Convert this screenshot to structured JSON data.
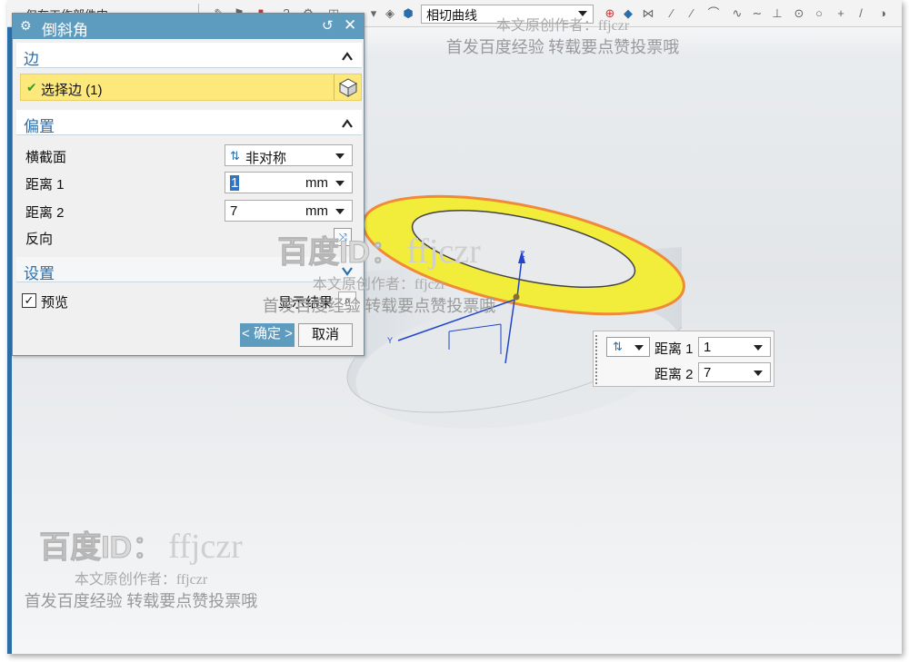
{
  "toolbar": {
    "left_text": "仅在工作部件内",
    "curve_rule": "相切曲线"
  },
  "dialog": {
    "title": "倒斜角",
    "edge_section": {
      "header": "边",
      "select_label": "选择边 (1)"
    },
    "offset_section": {
      "header": "偏置",
      "cross_section_label": "横截面",
      "cross_section_value": "非对称",
      "distance1_label": "距离 1",
      "distance1_value": "1",
      "distance1_unit": "mm",
      "distance2_label": "距离 2",
      "distance2_value": "7",
      "distance2_unit": "mm",
      "reverse_label": "反向"
    },
    "settings_section": {
      "header": "设置"
    },
    "preview_label": "预览",
    "preview_checked": true,
    "show_result_label": "显示结果",
    "ok_label": "确定",
    "ok_prefix": "<",
    "ok_suffix": ">",
    "cancel_label": "取消"
  },
  "onscreen_input": {
    "distance1_label": "距离 1",
    "distance1_value": "1",
    "distance2_label": "距离 2",
    "distance2_value": "7"
  },
  "axes": {
    "z": "Z",
    "y": "Y"
  },
  "watermark": {
    "id_prefix": "百度ID：",
    "id": "ffjczr",
    "author_line": "本文原创作者：ffjczr",
    "notice_line": "首发百度经验 转载要点赞投票哦"
  },
  "colors": {
    "title_bar": "#5d9bbf",
    "accent_blue": "#2b6ea8",
    "selection_yellow": "#fde87c",
    "chamfer_face": "#f2ec3a",
    "edge_orange": "#f08a3a"
  }
}
